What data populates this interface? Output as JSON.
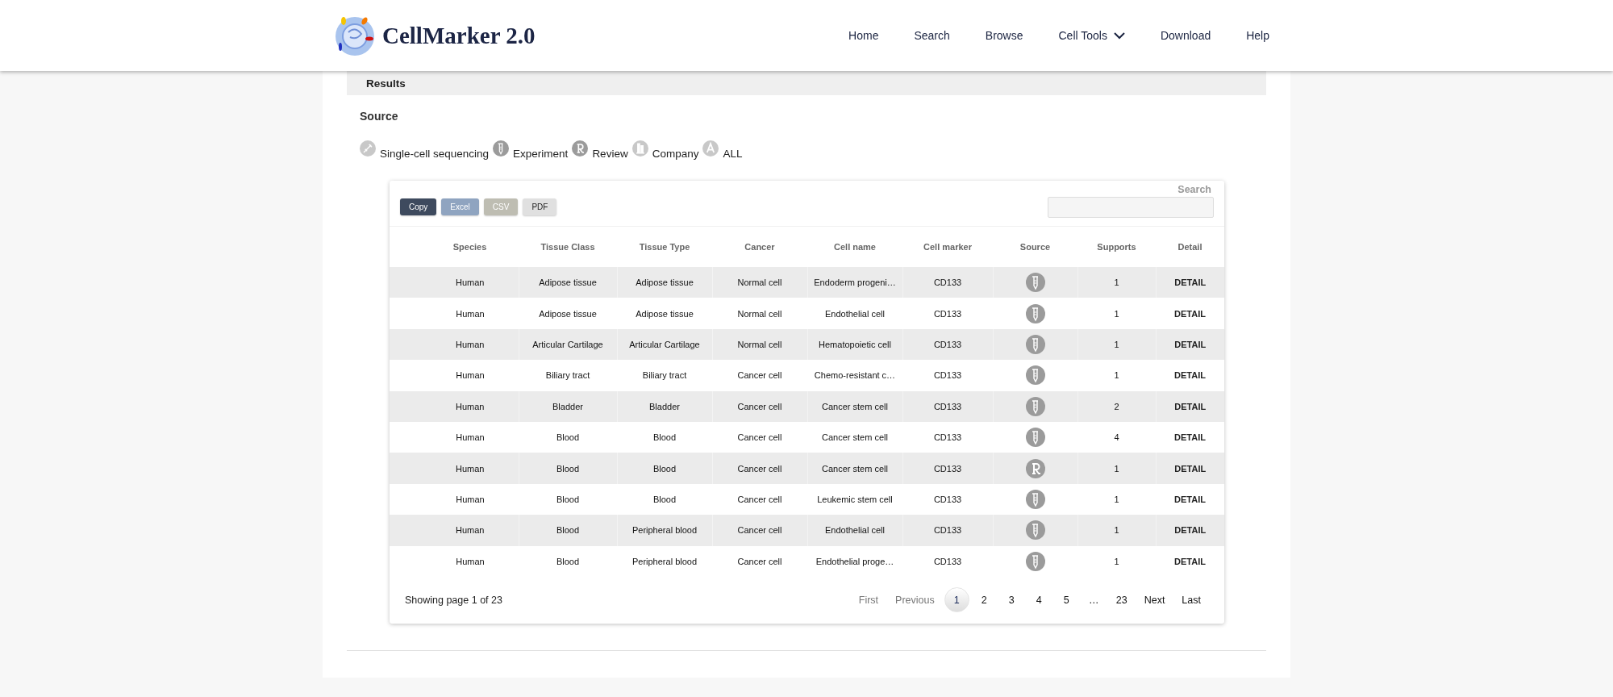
{
  "header": {
    "logo_text": "CellMarker 2.0",
    "nav": [
      {
        "label": "Home",
        "has_menu": false
      },
      {
        "label": "Search",
        "has_menu": false
      },
      {
        "label": "Browse",
        "has_menu": false
      },
      {
        "label": "Cell Tools",
        "has_menu": true
      },
      {
        "label": "Download",
        "has_menu": false
      },
      {
        "label": "Help",
        "has_menu": false
      }
    ]
  },
  "results": {
    "title": "Results",
    "source_title": "Source",
    "legend": [
      {
        "kind": "single-cell",
        "label": "Single-cell sequencing"
      },
      {
        "kind": "experiment",
        "label": "Experiment"
      },
      {
        "kind": "review",
        "label": "Review"
      },
      {
        "kind": "company",
        "label": "Company"
      },
      {
        "kind": "all",
        "label": "ALL"
      }
    ]
  },
  "table": {
    "export_buttons": [
      {
        "kind": "copy",
        "label": "Copy"
      },
      {
        "kind": "excel",
        "label": "Excel"
      },
      {
        "kind": "csv",
        "label": "CSV"
      },
      {
        "kind": "pdf",
        "label": "PDF"
      }
    ],
    "search_label": "Search",
    "columns": [
      "Species",
      "Tissue Class",
      "Tissue Type",
      "Cancer",
      "Cell name",
      "Cell marker",
      "Source",
      "Supports",
      "Detail"
    ],
    "rows": [
      {
        "species": "Human",
        "tissue_class": "Adipose tissue",
        "tissue_type": "Adipose tissue",
        "cancer": "Normal cell",
        "cell_name": "Endoderm progeni…",
        "cell_marker": "CD133",
        "source_icon": {
          "kind": "experiment"
        },
        "supports": "1",
        "detail": "DETAIL"
      },
      {
        "species": "Human",
        "tissue_class": "Adipose tissue",
        "tissue_type": "Adipose tissue",
        "cancer": "Normal cell",
        "cell_name": "Endothelial cell",
        "cell_marker": "CD133",
        "source_icon": {
          "kind": "experiment"
        },
        "supports": "1",
        "detail": "DETAIL"
      },
      {
        "species": "Human",
        "tissue_class": "Articular Cartilage",
        "tissue_type": "Articular Cartilage",
        "cancer": "Normal cell",
        "cell_name": "Hematopoietic cell",
        "cell_marker": "CD133",
        "source_icon": {
          "kind": "experiment"
        },
        "supports": "1",
        "detail": "DETAIL"
      },
      {
        "species": "Human",
        "tissue_class": "Biliary tract",
        "tissue_type": "Biliary tract",
        "cancer": "Cancer cell",
        "cell_name": "Chemo-resistant c…",
        "cell_marker": "CD133",
        "source_icon": {
          "kind": "experiment"
        },
        "supports": "1",
        "detail": "DETAIL"
      },
      {
        "species": "Human",
        "tissue_class": "Bladder",
        "tissue_type": "Bladder",
        "cancer": "Cancer cell",
        "cell_name": "Cancer stem cell",
        "cell_marker": "CD133",
        "source_icon": {
          "kind": "experiment"
        },
        "supports": "2",
        "detail": "DETAIL"
      },
      {
        "species": "Human",
        "tissue_class": "Blood",
        "tissue_type": "Blood",
        "cancer": "Cancer cell",
        "cell_name": "Cancer stem cell",
        "cell_marker": "CD133",
        "source_icon": {
          "kind": "experiment"
        },
        "supports": "4",
        "detail": "DETAIL"
      },
      {
        "species": "Human",
        "tissue_class": "Blood",
        "tissue_type": "Blood",
        "cancer": "Cancer cell",
        "cell_name": "Cancer stem cell",
        "cell_marker": "CD133",
        "source_icon": {
          "kind": "review"
        },
        "supports": "1",
        "detail": "DETAIL"
      },
      {
        "species": "Human",
        "tissue_class": "Blood",
        "tissue_type": "Blood",
        "cancer": "Cancer cell",
        "cell_name": "Leukemic stem cell",
        "cell_marker": "CD133",
        "source_icon": {
          "kind": "experiment"
        },
        "supports": "1",
        "detail": "DETAIL"
      },
      {
        "species": "Human",
        "tissue_class": "Blood",
        "tissue_type": "Peripheral blood",
        "cancer": "Cancer cell",
        "cell_name": "Endothelial cell",
        "cell_marker": "CD133",
        "source_icon": {
          "kind": "experiment"
        },
        "supports": "1",
        "detail": "DETAIL"
      },
      {
        "species": "Human",
        "tissue_class": "Blood",
        "tissue_type": "Peripheral blood",
        "cancer": "Cancer cell",
        "cell_name": "Endothelial proge…",
        "cell_marker": "CD133",
        "source_icon": {
          "kind": "experiment"
        },
        "supports": "1",
        "detail": "DETAIL"
      }
    ],
    "info": "Showing page 1 of 23",
    "pagination": [
      {
        "label": "First",
        "selected": false,
        "disabled": true
      },
      {
        "label": "Previous",
        "selected": false,
        "disabled": true
      },
      {
        "label": "1",
        "selected": true,
        "disabled": false
      },
      {
        "label": "2",
        "selected": false,
        "disabled": false
      },
      {
        "label": "3",
        "selected": false,
        "disabled": false
      },
      {
        "label": "4",
        "selected": false,
        "disabled": false
      },
      {
        "label": "5",
        "selected": false,
        "disabled": false
      },
      {
        "label": "…",
        "selected": false,
        "disabled": false
      },
      {
        "label": "23",
        "selected": false,
        "disabled": false
      },
      {
        "label": "Next",
        "selected": false,
        "disabled": false
      },
      {
        "label": "Last",
        "selected": false,
        "disabled": false
      }
    ]
  }
}
